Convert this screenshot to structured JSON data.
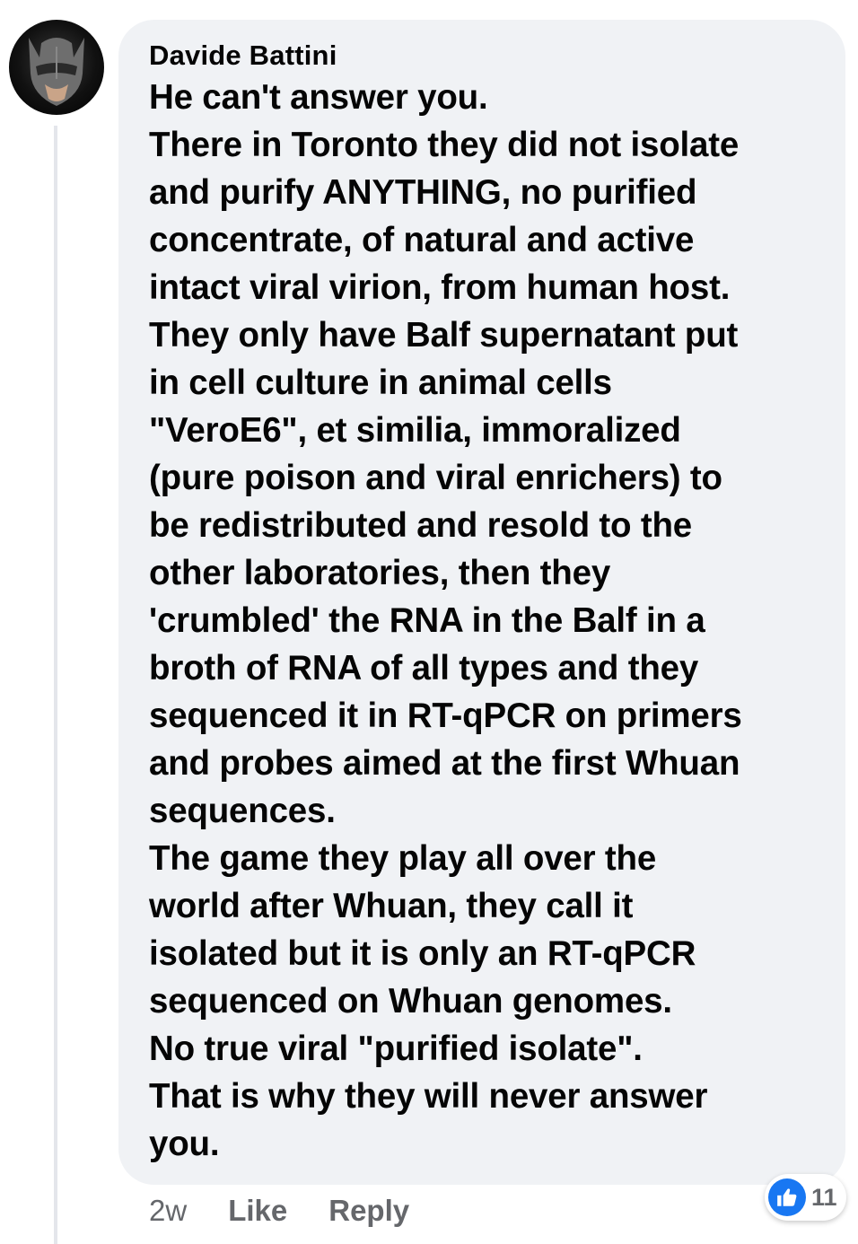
{
  "comment": {
    "author": "Davide Battini",
    "text": "He can't answer you.\nThere in Toronto they did not isolate\nand purify ANYTHING, no purified\nconcentrate, of natural and active\nintact viral virion, from human host.\nThey only have Balf supernatant put\nin cell culture in animal cells\n\"VeroE6\", et similia, immoralized\n(pure poison and viral enrichers) to\nbe redistributed and resold to the\nother laboratories, then they\n'crumbled' the RNA in the Balf in a\nbroth of RNA of all types and they\nsequenced it in RT-qPCR on primers\nand probes aimed at the first Whuan\nsequences.\nThe game they play all over the\nworld after Whuan, they call it\nisolated but it is only an RT-qPCR\nsequenced on Whuan genomes.\nNo true viral \"purified isolate\".\nThat is why they will never answer\nyou.",
    "timestamp": "2w",
    "like_label": "Like",
    "reply_label": "Reply",
    "reaction_count": "11",
    "reaction_icon": "thumbs-up-icon"
  },
  "colors": {
    "bubble": "#f0f2f5",
    "text": "#050505",
    "meta": "#65676b",
    "like_blue": "#1877f2"
  }
}
